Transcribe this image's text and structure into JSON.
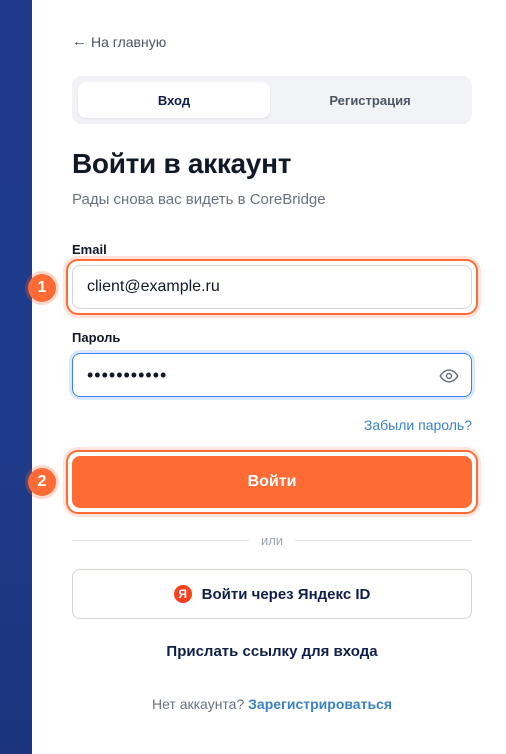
{
  "back_link": {
    "arrow": "←",
    "label": "На главную"
  },
  "tabs": [
    {
      "label": "Вход",
      "active": true
    },
    {
      "label": "Регистрация",
      "active": false
    }
  ],
  "title": "Войти в аккаунт",
  "subtitle": "Рады снова вас видеть в CoreBridge",
  "email": {
    "label": "Email",
    "value": "client@example.ru"
  },
  "password": {
    "label": "Пароль",
    "masked_value": "•••••••••••"
  },
  "forgot_link": "Забыли пароль?",
  "login_button": "Войти",
  "markers": [
    "1",
    "2"
  ],
  "divider_text": "или",
  "yandex": {
    "icon_letter": "Я",
    "label": "Войти через Яндекс ID"
  },
  "magic_link": "Прислать ссылку для входа",
  "signup": {
    "prompt": "Нет аккаунта?",
    "link": "Зарегистрироваться"
  },
  "colors": {
    "accent": "#ff6b35",
    "primary_dark": "#0f1f4b",
    "link": "#3b82c4",
    "sidebar": "#1e3a8a"
  }
}
